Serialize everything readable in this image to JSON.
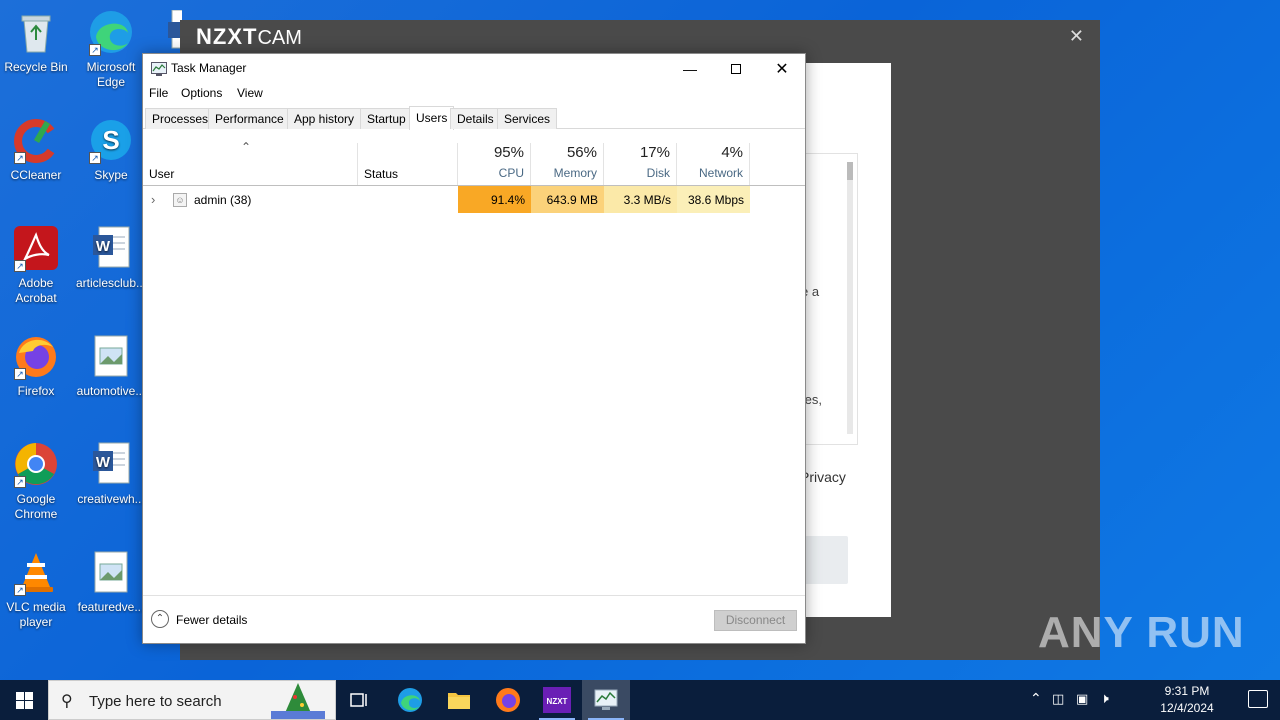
{
  "desktop": {
    "icons": [
      {
        "label": "Recycle Bin"
      },
      {
        "label": "Microsoft Edge"
      },
      {
        "label": "CCleaner"
      },
      {
        "label": "Skype"
      },
      {
        "label": "Adobe Acrobat"
      },
      {
        "label": "articlesclub..."
      },
      {
        "label": "Firefox"
      },
      {
        "label": "automotive..."
      },
      {
        "label": "Google Chrome"
      },
      {
        "label": "creativewh..."
      },
      {
        "label": "VLC media player"
      },
      {
        "label": "featuredve..."
      }
    ]
  },
  "nzxt": {
    "brand": "NZXT",
    "product": "CAM",
    "close_icon": "✕",
    "fragment1": "e a",
    "fragment2": "tes,",
    "fragment3": "Privacy"
  },
  "taskmanager": {
    "title": "Task Manager",
    "menu": [
      "File",
      "Options",
      "View"
    ],
    "tabs": [
      "Processes",
      "Performance",
      "App history",
      "Startup",
      "Users",
      "Details",
      "Services"
    ],
    "active_tab": "Users",
    "columns": {
      "user": "User",
      "status": "Status",
      "cpu": {
        "pct": "95%",
        "label": "CPU"
      },
      "memory": {
        "pct": "56%",
        "label": "Memory"
      },
      "disk": {
        "pct": "17%",
        "label": "Disk"
      },
      "network": {
        "pct": "4%",
        "label": "Network"
      }
    },
    "rows": [
      {
        "user": "admin (38)",
        "status": "",
        "cpu": "91.4%",
        "memory": "643.9 MB",
        "disk": "3.3 MB/s",
        "network": "38.6 Mbps"
      }
    ],
    "footer": {
      "fewer_details": "Fewer details",
      "disconnect": "Disconnect"
    }
  },
  "taskbar": {
    "search_placeholder": "Type here to search",
    "time": "9:31 PM",
    "date": "12/4/2024"
  },
  "watermark": "ANY RUN",
  "colors": {
    "cpu_heat": "#f9a825",
    "memory_heat": "#fbd27a",
    "disk_heat": "#fbe9a8",
    "network_heat": "#fbefb8",
    "desktop_blue": "#0a64d8",
    "taskbar": "#0a1e3c"
  }
}
